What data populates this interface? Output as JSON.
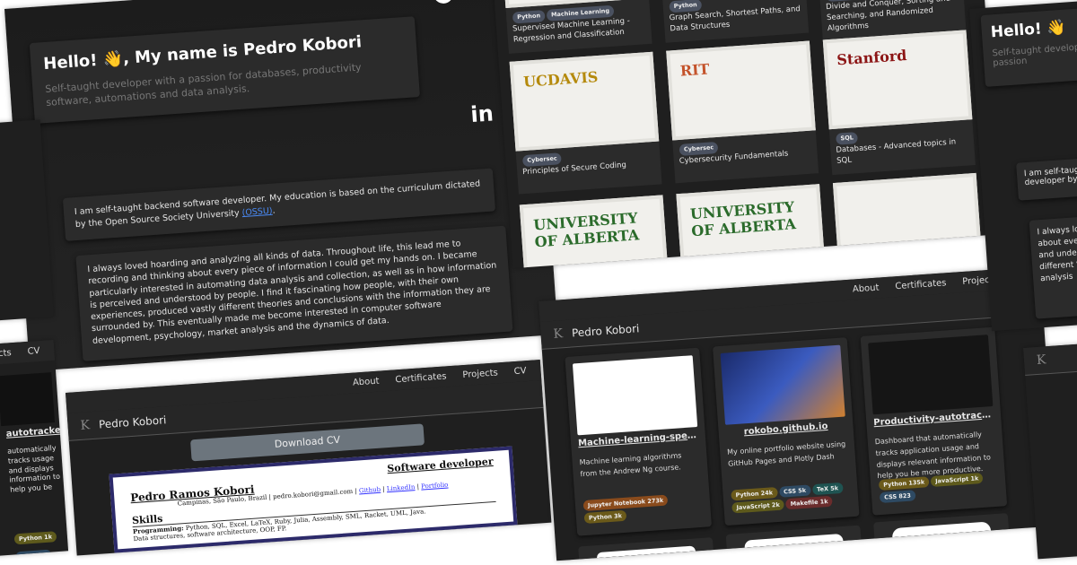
{
  "about": {
    "greeting": "Hello! 👋, My name is Pedro Kobori",
    "tagline": "Self-taught developer with a passion for databases, productivity software, automations and data analysis.",
    "intro_text": "I am self-taught backend software developer. My education is based on the curriculum dictated by the Open Source Society University ",
    "intro_link": "(OSSU)",
    "intro_end": ".",
    "story": "I always loved hoarding and analyzing all kinds of data. Throughout life, this lead me to recording and thinking about every piece of information I could get my hands on. I became particularly interested in automating data analysis and collection, as well as in how information is perceived and understood by people. I find it fascinating how people, with their own experiences, produced vastly different theories and conclusions with the information they are surrounded by. This eventually made me become interested in computer software development, psychology, market analysis and the dynamics of data.",
    "github_icon": "github-icon",
    "linkedin_icon": "in"
  },
  "nav": {
    "brand": "Pedro Kobori",
    "items": [
      "About",
      "Certificates",
      "Projects",
      "CV"
    ]
  },
  "certificates": [
    {
      "tags": [
        "Python",
        "Machine Learning"
      ],
      "title": "Supervised Machine Learning - Regression and Classification"
    },
    {
      "tags": [
        "Python"
      ],
      "title": "Graph Search, Shortest Paths, and Data Structures"
    },
    {
      "tags": [
        "Python"
      ],
      "title": "Divide and Conquer, Sorting and Searching, and Randomized Algorithms"
    },
    {
      "tags": [
        "Cybersec"
      ],
      "title": "Principles of Secure Coding",
      "logo": "UCDAVIS"
    },
    {
      "tags": [
        "Cybersec"
      ],
      "title": "Cybersecurity Fundamentals",
      "logo": "RIT"
    },
    {
      "tags": [
        "SQL"
      ],
      "title": "Databases - Advanced topics in SQL",
      "logo": "Stanford"
    },
    {
      "tags": [],
      "title": "",
      "logo": "UNIVERSITY OF ALBERTA"
    },
    {
      "tags": [],
      "title": "",
      "logo": "UNIVERSITY OF ALBERTA"
    },
    {
      "tags": [],
      "title": "",
      "logo": ""
    }
  ],
  "cv": {
    "download_label": "Download CV",
    "name": "Pedro Ramos Kobori",
    "role": "Software developer",
    "contact": "Campinas, São Paulo, Brazil | pedro.kobori@gmail.com |",
    "links": [
      "Github",
      "LinkedIn",
      "Portfolio"
    ],
    "section": "Skills",
    "skills_label": "Programming:",
    "skills": "Python, SQL, Excel, LaTeX, Ruby, Julia, Assembly, SML, Racket, UML, Java.",
    "skills2": "Data structures, software architecture, OOP, FP."
  },
  "projects": [
    {
      "title": "Machine-learning-specialization",
      "desc": "Machine learning algorithms from the Andrew Ng course.",
      "tags": [
        {
          "label": "Jupyter Notebook 273k",
          "color": "#8a4b1c"
        },
        {
          "label": "Python 3k",
          "color": "#6b5a1a"
        }
      ]
    },
    {
      "title": "rokobo.github.io",
      "desc": "My online portfolio website using GitHub Pages and Plotly Dash",
      "tags": [
        {
          "label": "Python 24k",
          "color": "#6b5a1a"
        },
        {
          "label": "CSS 5k",
          "color": "#2e4a63"
        },
        {
          "label": "TeX 5k",
          "color": "#1f5452"
        },
        {
          "label": "JavaScript 2k",
          "color": "#5e5a1c"
        },
        {
          "label": "Makefile 1k",
          "color": "#6a2c2c"
        }
      ]
    },
    {
      "title": "Productivity-autotracker",
      "desc": "Dashboard that automatically tracks application usage and displays relevant information to help you be more productive.",
      "tags": [
        {
          "label": "Python 135k",
          "color": "#6b5a1a"
        },
        {
          "label": "JavaScript 1k",
          "color": "#5e5a1c"
        },
        {
          "label": "CSS 823",
          "color": "#2e4a63"
        }
      ]
    }
  ],
  "edge": {
    "about_partial": "Hello! 👋",
    "about_tagline": "Self-taught developer with a passion",
    "about_intro": "I am self-taught backend software developer by the Open Source",
    "story_partial": "I always loved hoarding and thinking about every interested in automating and understood by people. vastly different theories eventually made me analysis",
    "proj_title": "autotracker",
    "proj_desc": "automatically tracks usage and displays information to help you be",
    "left_tags": [
      "Python 1k",
      "CSS 823"
    ]
  }
}
